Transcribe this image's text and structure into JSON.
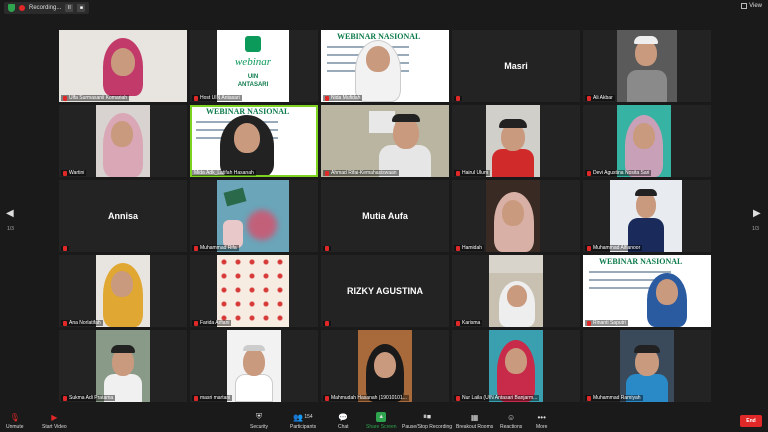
{
  "topbar": {
    "recording_label": "Recording...",
    "pause_glyph": "II",
    "stop_glyph": "■",
    "view_label": "View"
  },
  "pager": {
    "left": "1/3",
    "right": "1/3"
  },
  "participants": [
    {
      "id": "p1",
      "name": "Ulfa Surmasanii Komariah",
      "type": "video",
      "muted": true
    },
    {
      "id": "p2",
      "name": "Host UIN Antasari",
      "type": "logo",
      "muted": true
    },
    {
      "id": "p3",
      "name": "Nida Mufidah",
      "type": "video",
      "muted": true
    },
    {
      "id": "p4",
      "name": "Masri",
      "type": "name",
      "muted": true
    },
    {
      "id": "p5",
      "name": "Ali Akbar",
      "type": "video",
      "muted": true
    },
    {
      "id": "p6",
      "name": "Wartini",
      "type": "video",
      "muted": true
    },
    {
      "id": "p7",
      "name": "Mida Adk_Latifah Hasanah",
      "type": "video",
      "muted": false,
      "speaking": true
    },
    {
      "id": "p8",
      "name": "Ahmad Rifai-Kemahasiswaan",
      "type": "video",
      "muted": true
    },
    {
      "id": "p9",
      "name": "Hairul Ulum",
      "type": "video",
      "muted": true
    },
    {
      "id": "p10",
      "name": "Devi Agustina Nosita Sari",
      "type": "video",
      "muted": true
    },
    {
      "id": "p11",
      "name": "Annisa",
      "type": "name",
      "muted": true
    },
    {
      "id": "p12",
      "name": "Muhammad Rifa",
      "type": "video",
      "muted": true
    },
    {
      "id": "p13",
      "name": "Mutia Aufa",
      "type": "name",
      "muted": true
    },
    {
      "id": "p14",
      "name": "Hamidah",
      "type": "video",
      "muted": true
    },
    {
      "id": "p15",
      "name": "Muhammad Alfianoor",
      "type": "video",
      "muted": true
    },
    {
      "id": "p16",
      "name": "Ana Norlatifah",
      "type": "video",
      "muted": true
    },
    {
      "id": "p17",
      "name": "Farida Arfiani",
      "type": "pattern",
      "muted": true
    },
    {
      "id": "p18",
      "name": "RIZKY AGUSTINA",
      "type": "name",
      "muted": true
    },
    {
      "id": "p19",
      "name": "Karisma",
      "type": "video",
      "muted": true
    },
    {
      "id": "p20",
      "name": "Rinanti Saputri",
      "type": "video",
      "muted": true
    },
    {
      "id": "p21",
      "name": "Sukma Adi Pratama",
      "type": "video",
      "muted": true
    },
    {
      "id": "p22",
      "name": "masri martani",
      "type": "video",
      "muted": true
    },
    {
      "id": "p23",
      "name": "Mahmudah Hasanah (19010101...",
      "type": "video",
      "muted": true
    },
    {
      "id": "p24",
      "name": "Nur Laila (UIN Antasari Banjarm...",
      "type": "video",
      "muted": true
    },
    {
      "id": "p25",
      "name": "Muhammad Ramiyah",
      "type": "video",
      "muted": true
    }
  ],
  "poster": {
    "title": "WEBINAR NASIONAL",
    "logo_word": "webinar",
    "logo_org": "ANTASARI",
    "logo_uin": "UIN"
  },
  "toolbar": {
    "unmute": "Unmute",
    "start_video": "Start Video",
    "security": "Security",
    "participants": "Participants",
    "participants_count": "154",
    "chat": "Chat",
    "share_screen": "Share Screen",
    "pause_recording": "Pause/Stop Recording",
    "breakout_rooms": "Breakout Rooms",
    "reactions": "Reactions",
    "more": "More",
    "end": "End"
  },
  "colors": {
    "accent_green": "#7ed321",
    "end_red": "#e02828",
    "share_green": "#2ea44f",
    "background": "#1a1a1a"
  }
}
